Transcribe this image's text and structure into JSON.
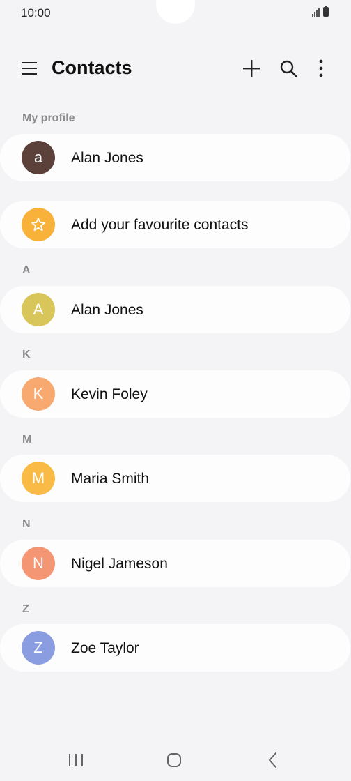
{
  "status_bar": {
    "time": "10:00"
  },
  "header": {
    "title": "Contacts"
  },
  "sections": {
    "profile": "My profile",
    "a": "A",
    "k": "K",
    "m": "M",
    "n": "N",
    "z": "Z"
  },
  "profile": {
    "name": "Alan Jones",
    "initial": "a",
    "color": "#5c413a"
  },
  "favourites": {
    "label": "Add your favourite contacts",
    "color": "#f8b23a"
  },
  "contacts": [
    {
      "initial": "A",
      "name": "Alan Jones",
      "color": "#d9c65a"
    },
    {
      "initial": "K",
      "name": "Kevin Foley",
      "color": "#f7a96f"
    },
    {
      "initial": "M",
      "name": "Maria Smith",
      "color": "#f9bb45"
    },
    {
      "initial": "N",
      "name": "Nigel Jameson",
      "color": "#f49574"
    },
    {
      "initial": "Z",
      "name": "Zoe Taylor",
      "color": "#8a9de0"
    }
  ]
}
